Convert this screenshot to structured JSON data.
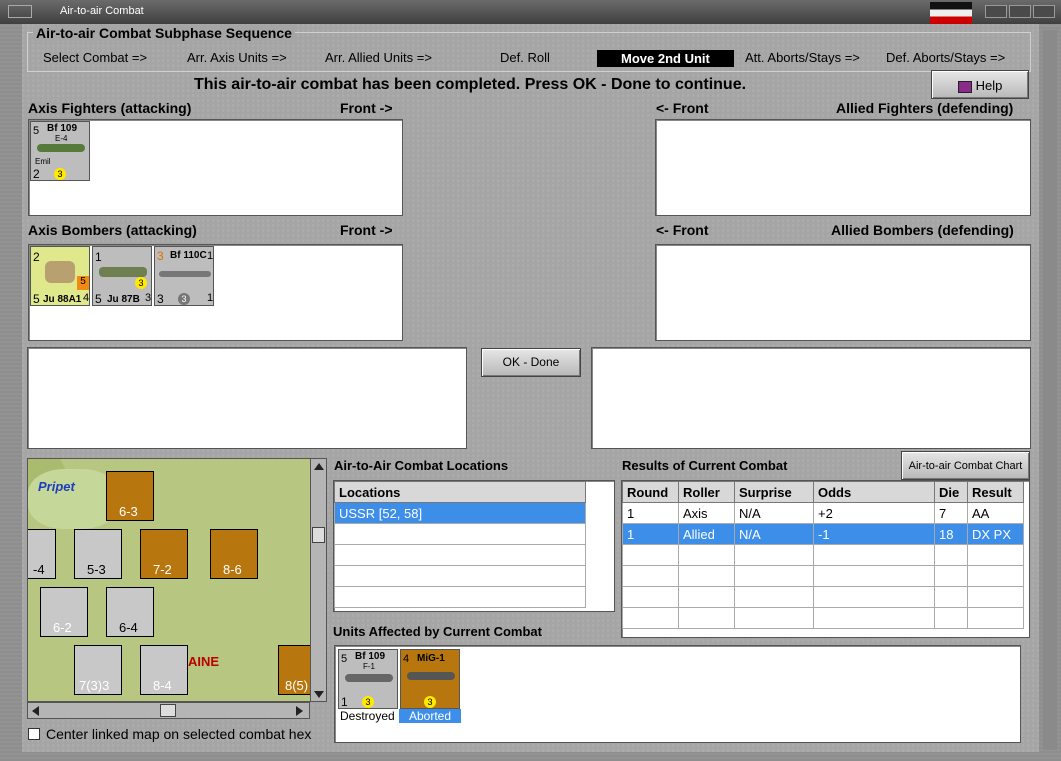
{
  "window": {
    "title": "Air-to-air Combat"
  },
  "sequence": {
    "legend": "Air-to-air Combat Subphase Sequence",
    "steps": [
      "Select Combat =>",
      "Arr. Axis Units =>",
      "Arr. Allied Units =>",
      "Def. Roll",
      "Move 2nd Unit",
      "Att. Aborts/Stays =>",
      "Def. Aborts/Stays =>"
    ],
    "active_step": "Move 2nd Unit"
  },
  "message": "This air-to-air combat has been completed.  Press OK - Done to continue.",
  "help_button": "Help",
  "ok_button": "OK - Done",
  "panels": {
    "axis_fighters": "Axis Fighters (attacking)",
    "allied_fighters": "Allied Fighters (defending)",
    "axis_bombers": "Axis Bombers (attacking)",
    "allied_bombers": "Allied Bombers (defending)",
    "front_right": "Front ->",
    "front_left": "<- Front"
  },
  "axis_fighter_units": [
    {
      "name": "Bf 109",
      "sub": "E-4",
      "nick": "Emil",
      "tl": "5",
      "bl": "2",
      "badge": "3"
    }
  ],
  "axis_bomber_units": [
    {
      "name": "Ju 88A1",
      "tl": "2",
      "bl": "5",
      "br": "4",
      "badge": "5"
    },
    {
      "name": "Ju 87B",
      "tl": "1",
      "bl": "5",
      "br": "3",
      "badge": "3"
    },
    {
      "name": "Bf 110C",
      "tl": "3",
      "tr": "1",
      "bl": "3",
      "br": "1",
      "badge": "3"
    }
  ],
  "locations": {
    "title": "Air-to-Air Combat Locations",
    "header": "Locations",
    "rows": [
      "USSR [52, 58]",
      "",
      "",
      "",
      "",
      ""
    ]
  },
  "results": {
    "title": "Results of Current Combat",
    "chart_button": "Air-to-air Combat Chart",
    "headers": [
      "Round",
      "Roller",
      "Surprise",
      "Odds",
      "Die",
      "Result"
    ],
    "rows": [
      [
        "1",
        "Axis",
        "N/A",
        "+2",
        "7",
        "AA"
      ],
      [
        "1",
        "Allied",
        "N/A",
        "-1",
        "18",
        "DX PX"
      ],
      [
        "",
        "",
        "",
        "",
        "",
        ""
      ],
      [
        "",
        "",
        "",
        "",
        "",
        ""
      ],
      [
        "",
        "",
        "",
        "",
        "",
        ""
      ],
      [
        "",
        "",
        "",
        "",
        "",
        ""
      ]
    ]
  },
  "affected": {
    "title": "Units Affected by Current Combat",
    "units": [
      {
        "name": "Bf 109",
        "sub": "F-1",
        "tl": "5",
        "bl": "1",
        "badge": "3",
        "status": "Destroyed"
      },
      {
        "name": "MiG-1",
        "tl": "4",
        "badge": "3",
        "status": "Aborted"
      }
    ]
  },
  "map": {
    "labels": [
      "Pripet",
      "AINE"
    ],
    "units": [
      {
        "v": "6-3"
      },
      {
        "v": "-4"
      },
      {
        "v": "5-3"
      },
      {
        "v": "7-2"
      },
      {
        "v": "8-6"
      },
      {
        "v": "6-2"
      },
      {
        "v": "6-4"
      },
      {
        "v": "7(3)3"
      },
      {
        "v": "8-4"
      },
      {
        "v": "8(5)"
      }
    ]
  },
  "center_checkbox": "Center linked map on selected combat hex",
  "colors": {
    "selection": "#3d8ee8",
    "badge": "#ffea00",
    "hex_orange": "#b8760f"
  }
}
